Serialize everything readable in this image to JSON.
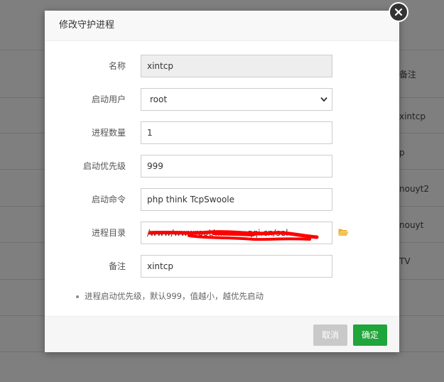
{
  "background": {
    "column_header": "备注",
    "cells": [
      "xintcp",
      "p",
      "nouyt2",
      "nouyt",
      "TV"
    ]
  },
  "dialog": {
    "title": "修改守护进程",
    "fields": {
      "name": {
        "label": "名称",
        "value": "xintcp"
      },
      "user": {
        "label": "启动用户",
        "value": "root"
      },
      "process_count": {
        "label": "进程数量",
        "value": "1"
      },
      "priority": {
        "label": "启动优先级",
        "value": "999"
      },
      "command": {
        "label": "启动命令",
        "value": "php think TcpSwoole"
      },
      "directory": {
        "label": "进程目录",
        "value": "/www/wwwroot/............qqi.cn/sel"
      },
      "remark": {
        "label": "备注",
        "value": "xintcp"
      }
    },
    "tip": "进程启动优先级，默认999，值越小，越优先启动",
    "buttons": {
      "cancel": "取消",
      "ok": "确定"
    }
  },
  "colors": {
    "ok_button": "#20a53a",
    "cancel_button": "#c9c9c9",
    "folder_icon": "#e8b23a",
    "redaction": "#ff0000"
  }
}
